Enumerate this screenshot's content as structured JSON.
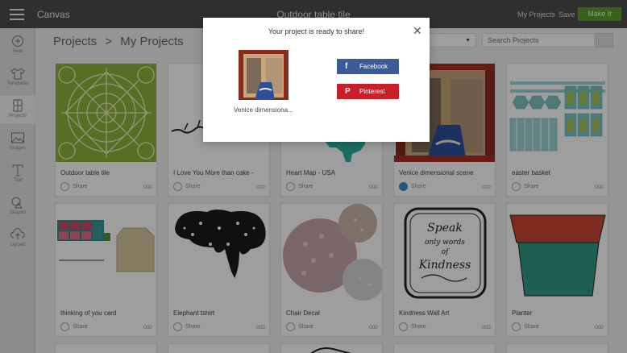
{
  "topbar": {
    "app_title": "Canvas",
    "project_title": "Outdoor table tile",
    "my_projects": "My Projects",
    "save": "Save",
    "make_it": "Make It"
  },
  "sidebar": {
    "items": [
      {
        "label": "New",
        "icon": "plus-circle-icon"
      },
      {
        "label": "Templates",
        "icon": "shirt-icon"
      },
      {
        "label": "Projects",
        "icon": "projects-icon"
      },
      {
        "label": "Images",
        "icon": "image-icon"
      },
      {
        "label": "Text",
        "icon": "text-icon"
      },
      {
        "label": "Shapes",
        "icon": "shapes-icon"
      },
      {
        "label": "Upload",
        "icon": "upload-icon"
      }
    ]
  },
  "header": {
    "breadcrumb_root": "Projects",
    "breadcrumb_sep": ">",
    "breadcrumb_current": "My Projects",
    "search_placeholder": "Search Projects"
  },
  "projects": [
    {
      "name": "Outdoor table tile",
      "share": "Share",
      "shared": false
    },
    {
      "name": "I Love You More than cake -",
      "share": "Share",
      "shared": false
    },
    {
      "name": "Heart Map - USA",
      "share": "Share",
      "shared": false
    },
    {
      "name": "Venice dimensional scene",
      "share": "Share",
      "shared": true
    },
    {
      "name": "easter basket",
      "share": "Share",
      "shared": false
    },
    {
      "name": "thinking of you card",
      "share": "Share",
      "shared": false
    },
    {
      "name": "Elephant tshirt",
      "share": "Share",
      "shared": false
    },
    {
      "name": "Chair Decal",
      "share": "Share",
      "shared": false
    },
    {
      "name": "Kindness Wall Art",
      "share": "Share",
      "shared": false
    },
    {
      "name": "Planter",
      "share": "Share",
      "shared": false
    }
  ],
  "kindness_art": {
    "line1": "Speak",
    "line2": "only words",
    "line3": "of",
    "line4": "Kindness"
  },
  "more_glyph": "ooo",
  "modal": {
    "title": "Your project is ready to share!",
    "close": "✕",
    "caption": "Venice dimensiona...",
    "facebook_icon": "f",
    "facebook_label": "Facebook",
    "pinterest_icon": "P",
    "pinterest_label": "Pinterest"
  },
  "colors": {
    "topbar": "#4c4c4c",
    "make_it": "#5a9e2a",
    "facebook": "#3b5b98",
    "pinterest": "#c8202b",
    "share_active": "#3d8fd0"
  }
}
